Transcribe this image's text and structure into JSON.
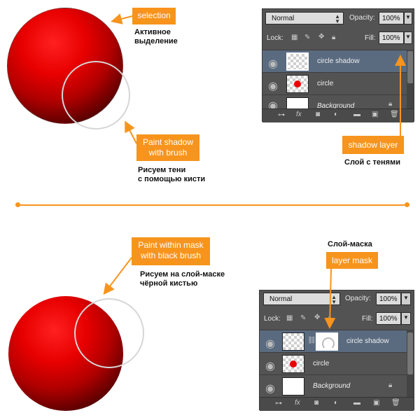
{
  "top": {
    "selection_label": "selection",
    "selection_rus_1": "Активное",
    "selection_rus_2": "выделение",
    "paint_shadow_1": "Paint shadow",
    "paint_shadow_2": "with brush",
    "paint_shadow_rus_1": "Рисуем тени",
    "paint_shadow_rus_2": "с помощью кисти",
    "shadow_layer_label": "shadow layer",
    "shadow_layer_rus": "Слой с тенями"
  },
  "bottom": {
    "paint_mask_1": "Paint within mask",
    "paint_mask_2": "with black brush",
    "paint_mask_rus_1": "Рисуем на слой-маске",
    "paint_mask_rus_2": "чёрной кистью",
    "layer_mask_rus": "Слой-маска",
    "layer_mask_label": "layer mask"
  },
  "panel": {
    "blend_mode": "Normal",
    "opacity_label": "Opacity:",
    "opacity_value": "100%",
    "lock_label": "Lock:",
    "fill_label": "Fill:",
    "fill_value": "100%",
    "layers": [
      {
        "name": "circle shadow"
      },
      {
        "name": "circle"
      },
      {
        "name": "Background"
      }
    ],
    "bottom_icons": [
      "link-icon",
      "fx-icon",
      "mask-icon",
      "adjustment-icon",
      "folder-icon",
      "new-layer-icon",
      "trash-icon"
    ],
    "fx_text": "fx"
  },
  "colors": {
    "accent": "#f7941d",
    "panel_bg": "#535353",
    "selected_row": "#5a6b80"
  }
}
